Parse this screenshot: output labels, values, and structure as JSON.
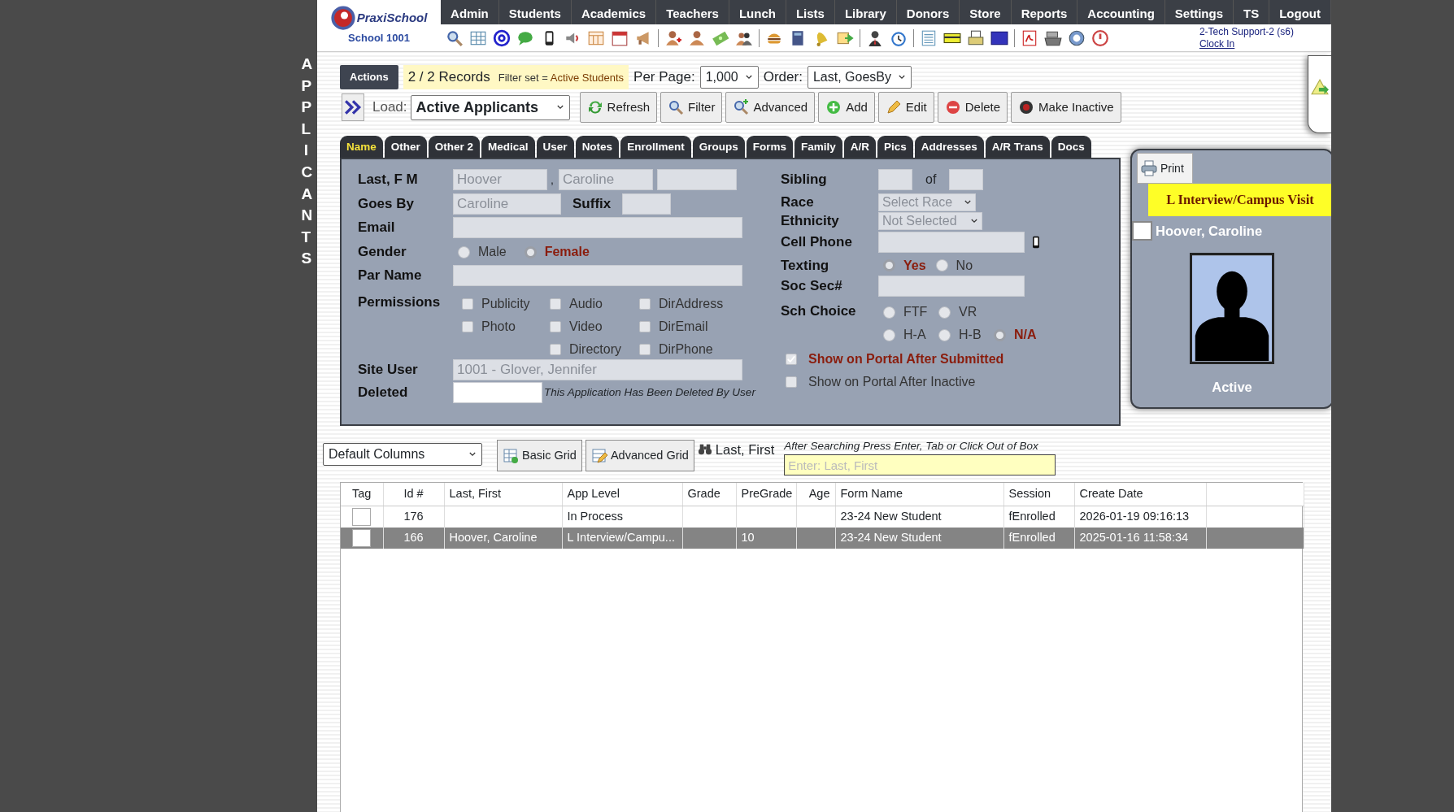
{
  "side_label": "APPLICANTS",
  "logo": {
    "name": "PraxiSchool",
    "school": "School 1001"
  },
  "nav": [
    "Admin",
    "Students",
    "Academics",
    "Teachers",
    "Lunch",
    "Lists",
    "Library",
    "Donors",
    "Store",
    "Reports",
    "Accounting",
    "Settings",
    "TS",
    "Logout"
  ],
  "user": {
    "name": "2-Tech Support-2 (s6)",
    "link": "Clock In"
  },
  "actions": "Actions",
  "records": "2 / 2 Records",
  "filter": {
    "label": "Filter set = ",
    "value": "Active Students"
  },
  "per_page": {
    "label": "Per Page:",
    "value": "1,000"
  },
  "order": {
    "label": "Order:",
    "value": "Last, GoesBy"
  },
  "load": {
    "label": "Load:",
    "value": "Active Applicants"
  },
  "buttons": [
    {
      "label": "Refresh",
      "kind": "refresh"
    },
    {
      "label": "Filter",
      "kind": "filter"
    },
    {
      "label": "Advanced",
      "kind": "advanced"
    },
    {
      "label": "Add",
      "kind": "add"
    },
    {
      "label": "Edit",
      "kind": "edit"
    },
    {
      "label": "Delete",
      "kind": "delete"
    },
    {
      "label": "Make Inactive",
      "kind": "inactive"
    }
  ],
  "tabs": [
    {
      "label": "Name",
      "selected": true
    },
    {
      "label": "Other",
      "selected": false
    },
    {
      "label": "Other 2",
      "selected": false
    },
    {
      "label": "Medical",
      "selected": false
    },
    {
      "label": "User",
      "selected": false
    },
    {
      "label": "Notes",
      "selected": false
    },
    {
      "label": "Enrollment",
      "selected": false
    },
    {
      "label": "Groups",
      "selected": false
    },
    {
      "label": "Forms",
      "selected": false
    },
    {
      "label": "Family",
      "selected": false
    },
    {
      "label": "A/R",
      "selected": false
    },
    {
      "label": "Pics",
      "selected": false
    },
    {
      "label": "Addresses",
      "selected": false
    },
    {
      "label": "A/R Trans",
      "selected": false
    },
    {
      "label": "Docs",
      "selected": false
    }
  ],
  "form": {
    "name": {
      "label": "Last, F M",
      "last": "Hoover",
      "separator": ",",
      "first": "Caroline"
    },
    "goes_by": {
      "label": "Goes By",
      "value": "Caroline"
    },
    "suffix": {
      "label": "Suffix"
    },
    "email": {
      "label": "Email"
    },
    "gender": {
      "label": "Gender",
      "options": [
        {
          "label": "Male",
          "selected": false
        },
        {
          "label": "Female",
          "selected": true
        }
      ]
    },
    "par_name": {
      "label": "Par Name"
    },
    "permissions": {
      "label": "Permissions",
      "columns": [
        [
          {
            "label": "Publicity",
            "checked": false
          },
          {
            "label": "Photo",
            "checked": false
          }
        ],
        [
          {
            "label": "Audio",
            "checked": false
          },
          {
            "label": "Video",
            "checked": false
          },
          {
            "label": "Directory",
            "checked": false
          }
        ],
        [
          {
            "label": "DirAddress",
            "checked": false
          },
          {
            "label": "DirEmail",
            "checked": false
          },
          {
            "label": "DirPhone",
            "checked": false
          }
        ]
      ]
    },
    "site_user": {
      "label": "Site User",
      "value": "1001 - Glover, Jennifer"
    },
    "deleted": {
      "label": "Deleted",
      "note": "This Application Has Been Deleted By User"
    },
    "sibling": {
      "label": "Sibling",
      "of": "of"
    },
    "race": {
      "label": "Race",
      "value": "Select Race"
    },
    "ethnicity": {
      "label": "Ethnicity",
      "value": "Not Selected"
    },
    "cell_phone": {
      "label": "Cell Phone"
    },
    "texting": {
      "label": "Texting",
      "options": [
        {
          "label": "Yes",
          "selected": true
        },
        {
          "label": "No",
          "selected": false
        }
      ]
    },
    "soc_sec": {
      "label": "Soc Sec#"
    },
    "sch_choice": {
      "label": "Sch Choice",
      "rows": [
        [
          {
            "label": "FTF",
            "selected": false
          },
          {
            "label": "VR",
            "selected": false
          }
        ],
        [
          {
            "label": "H-A",
            "selected": false
          },
          {
            "label": "H-B",
            "selected": false
          },
          {
            "label": "N/A",
            "selected": true
          }
        ]
      ]
    },
    "portal": [
      {
        "label": "Show on Portal After Submitted",
        "checked": true
      },
      {
        "label": "Show on Portal After Inactive",
        "checked": false
      }
    ]
  },
  "card": {
    "print": "Print",
    "status": "L Interview/Campus Visit",
    "tagged": false,
    "name": "Hoover, Caroline",
    "state": "Active"
  },
  "grid_bar": {
    "columns_select": "Default Columns",
    "basic": "Basic Grid",
    "advanced": "Advanced Grid",
    "search_label": "Last, First",
    "hint": "After Searching Press Enter, Tab or Click Out of Box",
    "placeholder": "Enter: Last, First"
  },
  "table": {
    "columns": [
      "Tag",
      "Id #",
      "Last, First",
      "App Level",
      "Grade",
      "PreGrade",
      "Age",
      "Form Name",
      "Session",
      "Create Date"
    ],
    "rows": [
      {
        "selected": false,
        "tagged": false,
        "cells": [
          "",
          "176",
          "",
          "In Process",
          "",
          "",
          "",
          "23-24 New Student",
          "fEnrolled",
          "2026-01-19 09:16:13"
        ]
      },
      {
        "selected": true,
        "tagged": false,
        "cells": [
          "",
          "166",
          "Hoover, Caroline",
          "L Interview/Campu...",
          "",
          "10",
          "",
          "23-24 New Student",
          "fEnrolled",
          "2025-01-16 11:58:34"
        ]
      }
    ]
  }
}
